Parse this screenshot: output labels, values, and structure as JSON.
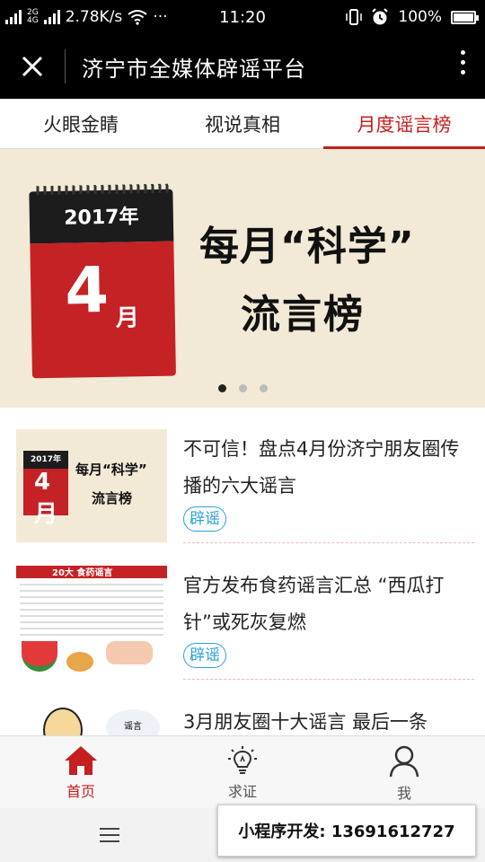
{
  "status": {
    "network": "4G",
    "network_sub": "2G",
    "speed": "2.78K/s",
    "time": "11:20",
    "battery": "100%"
  },
  "header": {
    "title": "济宁市全媒体辟谣平台"
  },
  "tabs": [
    {
      "label": "火眼金睛",
      "active": false
    },
    {
      "label": "视说真相",
      "active": false
    },
    {
      "label": "月度谣言榜",
      "active": true
    }
  ],
  "banner": {
    "year": "2017年",
    "month_num": "4",
    "month_unit": "月",
    "line1": "每月“科学”",
    "line2": "流言榜",
    "page_count": 3,
    "active_page": 1
  },
  "news": [
    {
      "title": "不可信！盘点4月份济宁朋友圈传播的六大谣言",
      "tag": "辟谣",
      "thumb": {
        "year": "2017年",
        "month": "4月",
        "t1": "每月“科学”",
        "t2": "流言榜"
      }
    },
    {
      "title": "官方发布食药谣言汇总 “西瓜打针”或死灰复燃",
      "tag": "辟谣",
      "thumb": {
        "header": "20大 食药谣言"
      }
    },
    {
      "title": "3月朋友圈十大谣言 最后一条",
      "tag": "",
      "thumb": {
        "bubble": "谣言"
      }
    }
  ],
  "bottom_nav": [
    {
      "label": "首页",
      "icon": "home-icon",
      "active": true
    },
    {
      "label": "求证",
      "icon": "lightbulb-icon",
      "active": false
    },
    {
      "label": "我",
      "icon": "person-icon",
      "active": false
    }
  ],
  "promo": {
    "text": "小程序开发: 13691612727"
  },
  "colors": {
    "accent": "#c51f1f",
    "tag": "#2aa1d8"
  }
}
